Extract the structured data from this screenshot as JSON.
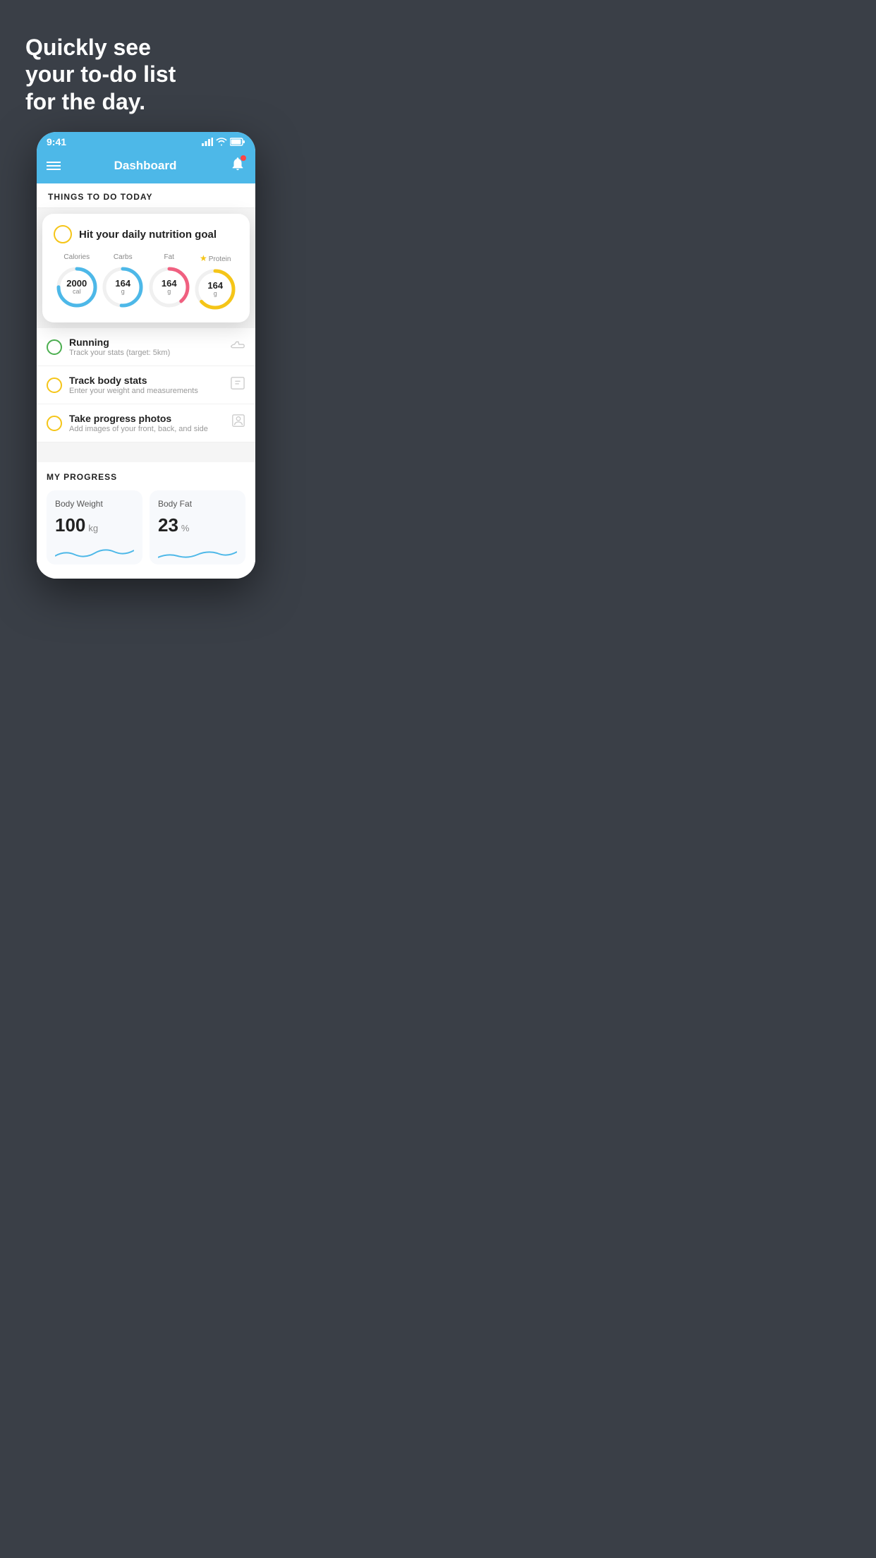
{
  "headline": {
    "line1": "Quickly see",
    "line2": "your to-do list",
    "line3": "for the day."
  },
  "statusBar": {
    "time": "9:41",
    "signal": "▉▉▉",
    "wifi": "wifi",
    "battery": "battery"
  },
  "navbar": {
    "title": "Dashboard"
  },
  "thingsHeader": "THINGS TO DO TODAY",
  "nutritionCard": {
    "title": "Hit your daily nutrition goal",
    "calories": {
      "label": "Calories",
      "value": "2000",
      "unit": "cal",
      "dasharray": "88",
      "dashoffset": "22"
    },
    "carbs": {
      "label": "Carbs",
      "value": "164",
      "unit": "g",
      "dasharray": "88",
      "dashoffset": "44"
    },
    "fat": {
      "label": "Fat",
      "value": "164",
      "unit": "g",
      "dasharray": "88",
      "dashoffset": "55"
    },
    "protein": {
      "label": "Protein",
      "value": "164",
      "unit": "g",
      "dasharray": "88",
      "dashoffset": "33"
    }
  },
  "todoItems": [
    {
      "type": "green",
      "title": "Running",
      "subtitle": "Track your stats (target: 5km)",
      "icon": "shoe"
    },
    {
      "type": "yellow",
      "title": "Track body stats",
      "subtitle": "Enter your weight and measurements",
      "icon": "scale"
    },
    {
      "type": "yellow",
      "title": "Take progress photos",
      "subtitle": "Add images of your front, back, and side",
      "icon": "person"
    }
  ],
  "progress": {
    "header": "MY PROGRESS",
    "bodyWeight": {
      "title": "Body Weight",
      "value": "100",
      "unit": "kg"
    },
    "bodyFat": {
      "title": "Body Fat",
      "value": "23",
      "unit": "%"
    }
  }
}
